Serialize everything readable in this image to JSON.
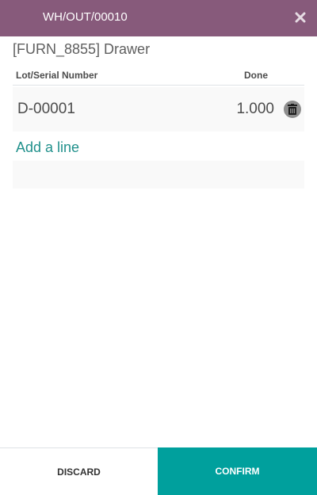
{
  "header": {
    "title": "WH/OUT/00010",
    "close_icon": "close-icon"
  },
  "product": {
    "title": "[FURN_8855] Drawer"
  },
  "table": {
    "columns": {
      "lot": "Lot/Serial Number",
      "done": "Done"
    },
    "rows": [
      {
        "lot": "D-00001",
        "done": "1.000",
        "action_icon": "trash-icon"
      }
    ],
    "add_line_label": "Add a line"
  },
  "footer": {
    "discard_label": "DISCARD",
    "confirm_label": "CONFIRM"
  },
  "colors": {
    "header_bg": "#875a7b",
    "accent": "#00a09d",
    "link": "#21918c"
  }
}
